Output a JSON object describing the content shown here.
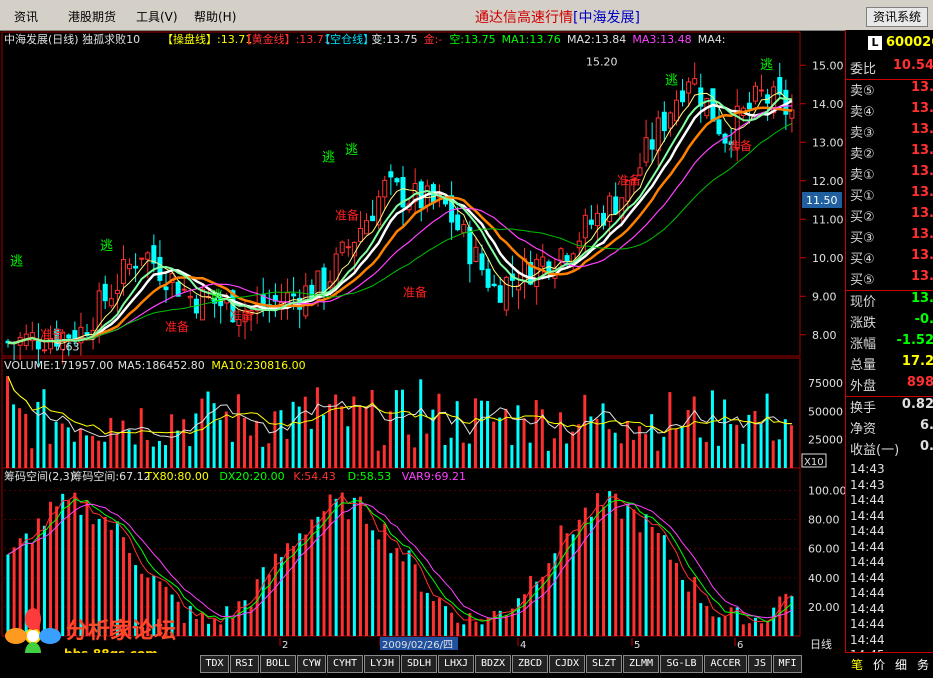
{
  "menu": [
    "资讯",
    "港股期货",
    "工具(V)",
    "帮助(H)"
  ],
  "title": {
    "main": "通达信高速行情",
    "stock": "[中海发展]"
  },
  "right_button": "资讯系统",
  "k_header": {
    "name": "中海发展(日线) 独孤求败10",
    "items": [
      {
        "label": "【操盘线】:13.71",
        "color": "#ffff00"
      },
      {
        "label": "【黄金线】:13.71",
        "color": "#ff3030"
      },
      {
        "label": "【空仓线】:-",
        "color": "#00e0ff"
      },
      {
        "label": "变:13.75",
        "color": "#e0e0e0"
      },
      {
        "label": "金:-",
        "color": "#ff3030"
      },
      {
        "label": "空:13.75",
        "color": "#00ff00"
      },
      {
        "label": "MA1:13.76",
        "color": "#00ff00"
      },
      {
        "label": "MA2:13.84",
        "color": "#e0e0e0"
      },
      {
        "label": "MA3:13.48",
        "color": "#ff40ff"
      },
      {
        "label": "MA4:",
        "color": "#e0e0e0"
      }
    ]
  },
  "k_axis": [
    "15.00",
    "14.00",
    "13.00",
    "12.00",
    "11.00",
    "10.00",
    "9.00",
    "8.00"
  ],
  "k_highlight": "11.50",
  "k_annotations": [
    {
      "text": "7.63",
      "color": "#e0e0e0"
    },
    {
      "text": "15.20",
      "color": "#e0e0e0"
    },
    {
      "text": "逃",
      "color": "#00ff00"
    },
    {
      "text": "准备",
      "color": "#ff2020"
    }
  ],
  "volume_header": [
    {
      "label": "VOLUME:171957.00",
      "color": "#e0e0e0"
    },
    {
      "label": "MA5:186452.80",
      "color": "#e0e0e0"
    },
    {
      "label": "MA10:230816.00",
      "color": "#ffff00"
    }
  ],
  "volume_axis": [
    "75000",
    "50000",
    "25000"
  ],
  "volume_unit": "X10",
  "chip_header": [
    {
      "label": "筹码空间(2,3)",
      "color": "#e0e0e0"
    },
    {
      "label": "筹码空间:67.12",
      "color": "#e0e0e0"
    },
    {
      "label": "TX80:80.00",
      "color": "#ffff00"
    },
    {
      "label": "DX20:20.00",
      "color": "#00ff00"
    },
    {
      "label": "K:54.43",
      "color": "#ff3030"
    },
    {
      "label": "D:58.53",
      "color": "#00ff00"
    },
    {
      "label": "VAR9:69.21",
      "color": "#ff40ff"
    }
  ],
  "chip_axis": [
    "100.00",
    "80.00",
    "60.00",
    "40.00",
    "20.00"
  ],
  "date_marks": [
    "2",
    "2009/02/26/四",
    "4",
    "5",
    "6"
  ],
  "period": "日线",
  "bottom_tabs": [
    "TDX",
    "RSI",
    "BOLL",
    "CYW",
    "CYHT",
    "LYJH",
    "SDLH",
    "LHXJ",
    "BDZX",
    "ZBCD",
    "CJDX",
    "SLZT",
    "ZLMM",
    "SG-LB",
    "ACCER",
    "JS",
    "MFI"
  ],
  "logo": {
    "text": "分析家论坛",
    "url": "bbs.88gs.com"
  },
  "sidebar": {
    "code": "600026",
    "rows": [
      {
        "label": "委比",
        "value": "10.54",
        "color": "#ff3030"
      },
      {
        "label": "卖⑤",
        "value": "13.",
        "color": "#ff3030"
      },
      {
        "label": "卖④",
        "value": "13.",
        "color": "#ff3030"
      },
      {
        "label": "卖③",
        "value": "13.",
        "color": "#ff3030"
      },
      {
        "label": "卖②",
        "value": "13.",
        "color": "#ff3030"
      },
      {
        "label": "卖①",
        "value": "13.",
        "color": "#ff3030"
      },
      {
        "label": "买①",
        "value": "13.",
        "color": "#ff3030"
      },
      {
        "label": "买②",
        "value": "13.",
        "color": "#ff3030"
      },
      {
        "label": "买③",
        "value": "13.",
        "color": "#ff3030"
      },
      {
        "label": "买④",
        "value": "13.",
        "color": "#ff3030"
      },
      {
        "label": "买⑤",
        "value": "13.",
        "color": "#ff3030"
      },
      {
        "label": "现价",
        "value": "13.",
        "color": "#00ff00"
      },
      {
        "label": "涨跌",
        "value": "-0.",
        "color": "#00ff00"
      },
      {
        "label": "涨幅",
        "value": "-1.52",
        "color": "#00ff00"
      },
      {
        "label": "总量",
        "value": "17.2",
        "color": "#ffff00"
      },
      {
        "label": "外盘",
        "value": "898",
        "color": "#ff3030"
      },
      {
        "label": "换手",
        "value": "0.82",
        "color": "#e0e0e0"
      },
      {
        "label": "净资",
        "value": "6.",
        "color": "#e0e0e0"
      },
      {
        "label": "收益(一)",
        "value": "0.",
        "color": "#e0e0e0"
      }
    ],
    "times": [
      "14:43",
      "14:43",
      "14:44",
      "14:44",
      "14:44",
      "14:44",
      "14:44",
      "14:44",
      "14:44",
      "14:44",
      "14:44",
      "14:44",
      "14:45"
    ],
    "tabs": [
      "笔",
      "价",
      "细",
      "务"
    ]
  },
  "chart_data": [
    {
      "type": "candlestick",
      "title": "中海发展(日线)",
      "ylim": [
        7.5,
        15.5
      ],
      "y_ticks": [
        8,
        9,
        10,
        11,
        12,
        13,
        14,
        15
      ]
    },
    {
      "type": "bar",
      "title": "VOLUME",
      "ylim": [
        0,
        90000
      ],
      "y_ticks": [
        25000,
        50000,
        75000
      ]
    },
    {
      "type": "bar",
      "title": "筹码空间(2,3)",
      "ylim": [
        0,
        110
      ],
      "y_ticks": [
        20,
        40,
        60,
        80,
        100
      ]
    }
  ]
}
